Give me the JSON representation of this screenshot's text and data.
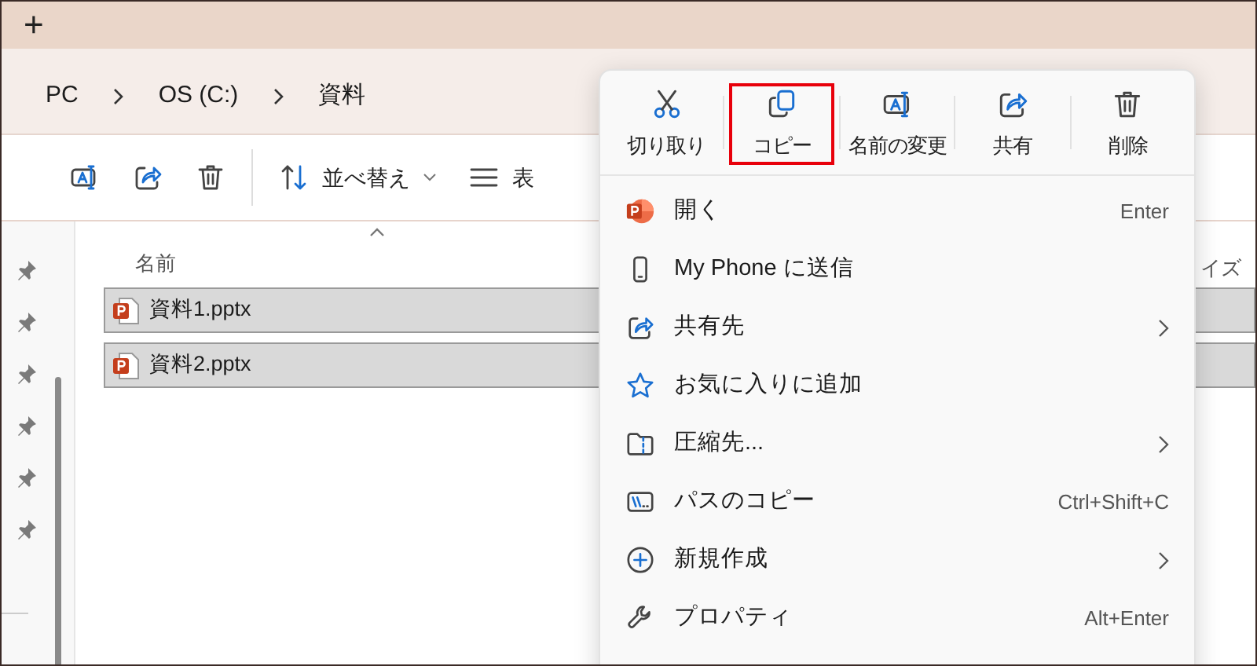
{
  "tab_strip": {
    "new_tab": "+"
  },
  "breadcrumb": [
    "PC",
    "OS (C:)",
    "資料"
  ],
  "toolbar": [
    {
      "kind": "rename"
    },
    {
      "kind": "share"
    },
    {
      "kind": "delete"
    },
    {
      "kind": "sort",
      "label": "並べ替え"
    },
    {
      "kind": "view",
      "label": "表"
    }
  ],
  "file_list": {
    "columns": [
      "名前",
      "イズ"
    ],
    "rows": [
      {
        "name": "資料1.pptx",
        "selected": true
      },
      {
        "name": "資料2.pptx",
        "selected": true
      }
    ]
  },
  "context_menu": {
    "quick_actions": [
      {
        "kind": "cut",
        "label": "切り取り",
        "highlighted": false
      },
      {
        "kind": "copy",
        "label": "コピー",
        "highlighted": true
      },
      {
        "kind": "rename",
        "label": "名前の変更",
        "highlighted": false
      },
      {
        "kind": "share",
        "label": "共有",
        "highlighted": false
      },
      {
        "kind": "delete",
        "label": "削除",
        "highlighted": false
      }
    ],
    "items": [
      {
        "kind": "powerpoint",
        "label": "開く",
        "shortcut": "Enter",
        "submenu": false
      },
      {
        "kind": "phone",
        "label": "My Phone に送信",
        "submenu": false
      },
      {
        "kind": "share",
        "label": "共有先",
        "submenu": true
      },
      {
        "kind": "star",
        "label": "お気に入りに追加",
        "submenu": false
      },
      {
        "kind": "zip",
        "label": "圧縮先...",
        "submenu": true
      },
      {
        "kind": "path",
        "label": "パスのコピー",
        "shortcut": "Ctrl+Shift+C",
        "submenu": false
      },
      {
        "kind": "new",
        "label": "新規作成",
        "submenu": true
      },
      {
        "kind": "wrench",
        "label": "プロパティ",
        "shortcut": "Alt+Enter",
        "submenu": false
      }
    ]
  }
}
